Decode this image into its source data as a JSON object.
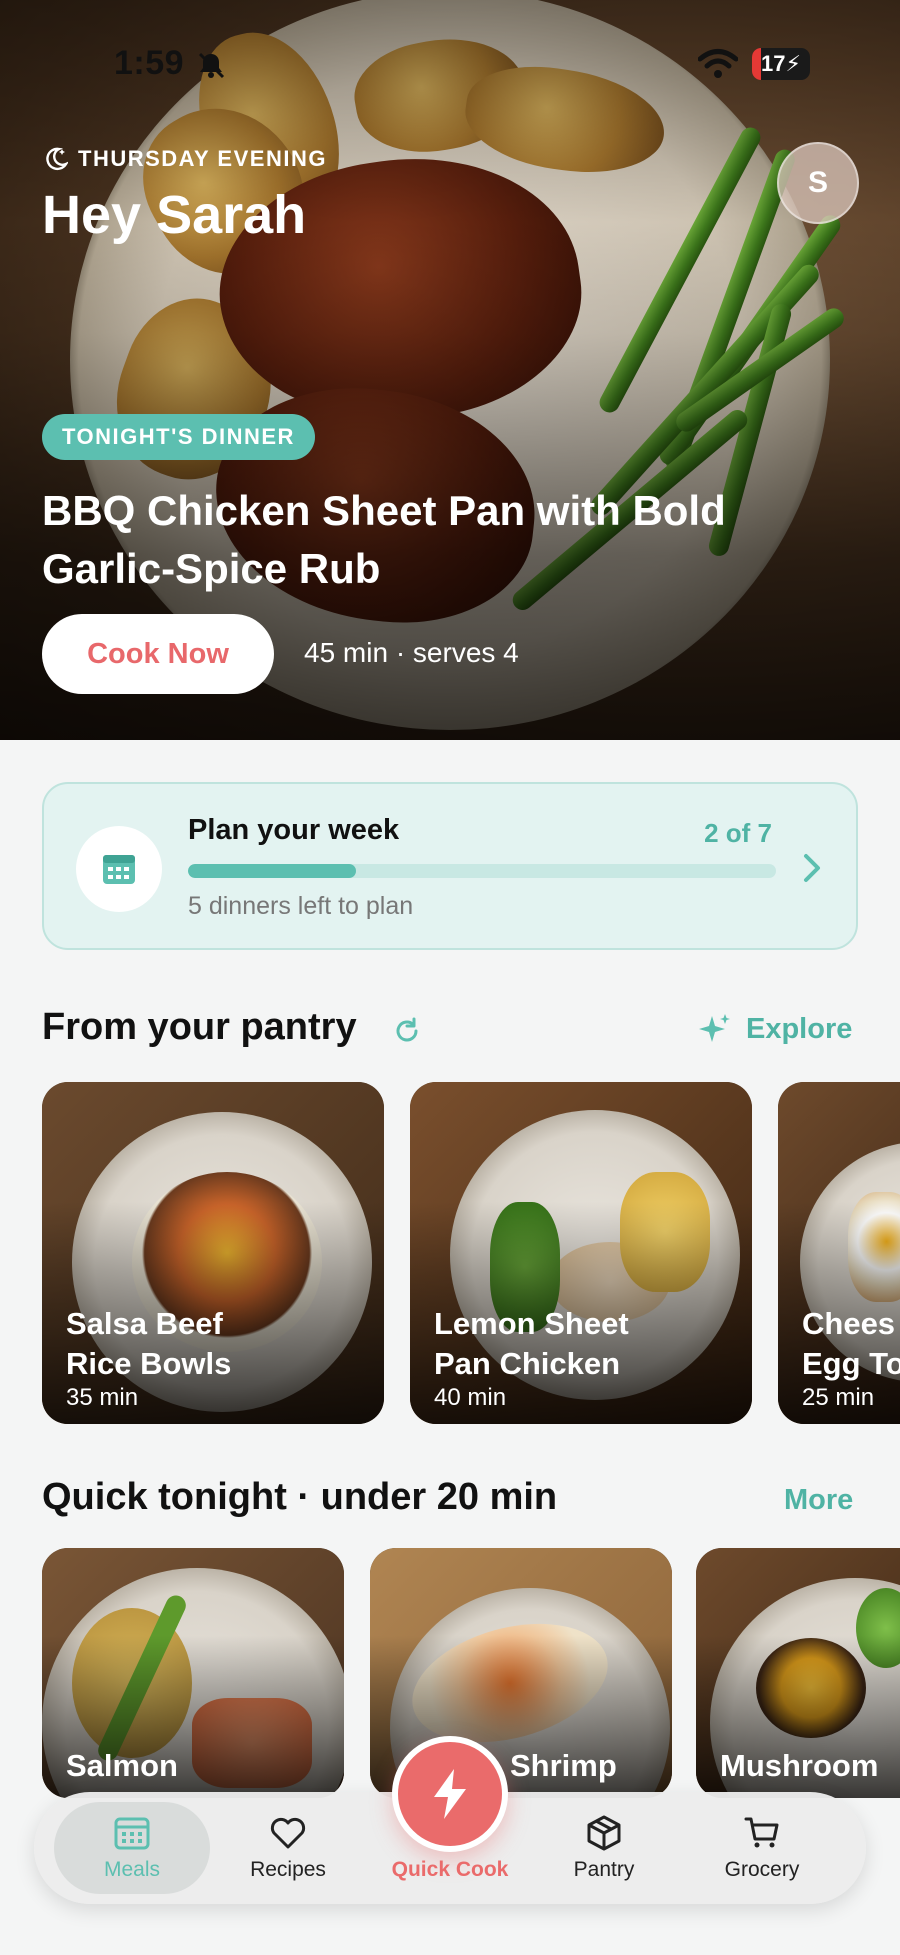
{
  "status_bar": {
    "time": "1:59",
    "battery": "17"
  },
  "hero": {
    "eyebrow": "THURSDAY EVENING",
    "greeting": "Hey Sarah",
    "avatar_initial": "S",
    "tag": "TONIGHT'S DINNER",
    "dish_title": "BBQ Chicken Sheet Pan with Bold Garlic-Spice Rub",
    "cook_button": "Cook Now",
    "meta": "45 min · serves 4"
  },
  "plan": {
    "title": "Plan your week",
    "count": "2 of 7",
    "progress": 0.2857,
    "subtitle": "5 dinners left to plan"
  },
  "pantry": {
    "title": "From your pantry",
    "link": "Explore",
    "cards": [
      {
        "name_line1": "Salsa Beef",
        "name_line2": "Rice Bowls",
        "time": "35 min"
      },
      {
        "name_line1": "Lemon Sheet",
        "name_line2": "Pan Chicken",
        "time": "40 min"
      },
      {
        "name_line1": "Chees",
        "name_line2": "Egg To",
        "time": "25 min"
      }
    ]
  },
  "quick": {
    "title": "Quick tonight · under 20 min",
    "link": "More",
    "cards": [
      {
        "name": "Salmon"
      },
      {
        "name": "Shrimp"
      },
      {
        "name": "Mushroom"
      }
    ]
  },
  "nav": {
    "meals": "Meals",
    "recipes": "Recipes",
    "quick_cook": "Quick Cook",
    "pantry": "Pantry",
    "grocery": "Grocery"
  },
  "colors": {
    "accent": "#5cbfb0",
    "coral": "#ea6b6b",
    "background": "#f4f5f5"
  }
}
